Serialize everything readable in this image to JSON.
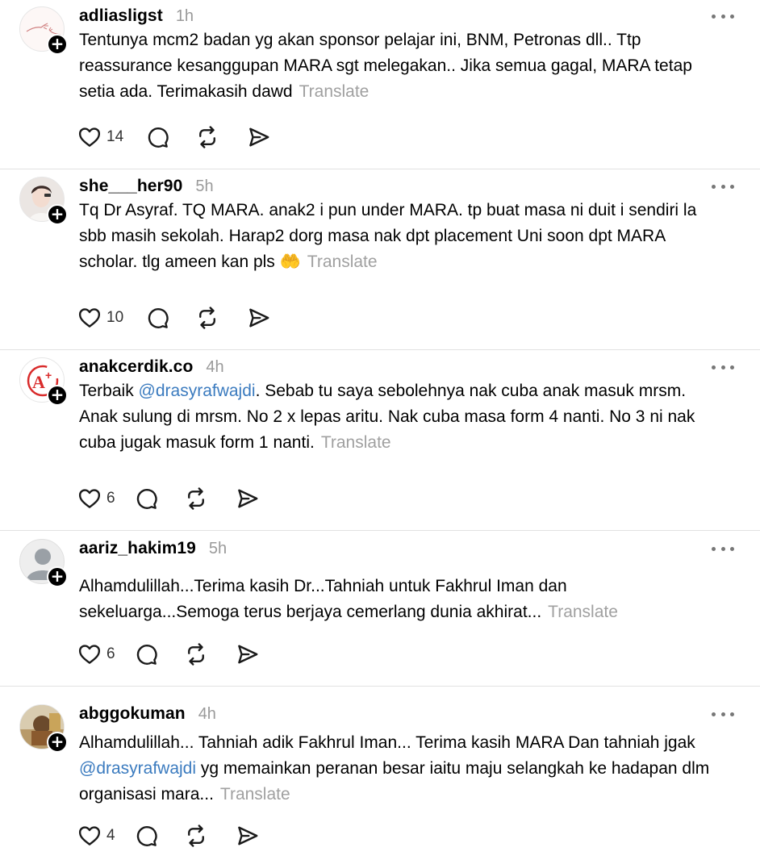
{
  "colors": {
    "mention": "#3b7bbf",
    "muted": "#9a9a9a",
    "divider": "#e2e2e2"
  },
  "posts": [
    {
      "username": "adliasligst",
      "time": "1h",
      "avatar": "sketch-hands-avatar",
      "text_before": "Tentunya mcm2 badan yg akan sponsor pelajar ini, BNM, Petronas dll.. Ttp reassurance kesanggupan MARA sgt melegakan.. Jika semua gagal, MARA tetap setia ada. Terimakasih dawd",
      "mention": "",
      "text_after": "",
      "translate": "Translate",
      "likes": "14"
    },
    {
      "username": "she___her90",
      "time": "5h",
      "avatar": "photo-avatar",
      "text_before": "Tq Dr Asyraf. TQ MARA. anak2 i pun under MARA. tp buat masa ni duit i sendiri la sbb masih sekolah. Harap2 dorg masa nak dpt placement Uni soon dpt MARA scholar. tlg ameen kan pls 🤲",
      "mention": "",
      "text_after": "",
      "translate": "Translate",
      "likes": "10"
    },
    {
      "username": "anakcerdik.co",
      "time": "4h",
      "avatar": "a-plus-logo-avatar",
      "text_before": "Terbaik ",
      "mention": "@drasyrafwajdi",
      "text_after": ". Sebab tu saya sebolehnya nak cuba anak masuk mrsm. Anak sulung di mrsm. No 2 x lepas aritu. Nak cuba masa form 4 nanti. No 3 ni nak cuba jugak masuk form 1 nanti.",
      "translate": "Translate",
      "likes": "6"
    },
    {
      "username": "aariz_hakim19",
      "time": "5h",
      "avatar": "default-person-avatar",
      "text_before": "Alhamdulillah...Terima kasih Dr...Tahniah untuk Fakhrul Iman dan sekeluarga...Semoga terus berjaya cemerlang dunia akhirat...",
      "mention": "",
      "text_after": "",
      "translate": "Translate",
      "likes": "6"
    },
    {
      "username": "abggokuman",
      "time": "4h",
      "avatar": "photo-avatar",
      "text_before": "Alhamdulillah... Tahniah adik Fakhrul Iman... Terima kasih MARA Dan tahniah jgak ",
      "mention": "@drasyrafwajdi",
      "text_after": " yg memainkan peranan besar iaitu maju selangkah ke hadapan dlm organisasi mara...",
      "translate": "Translate",
      "likes": "4"
    }
  ]
}
